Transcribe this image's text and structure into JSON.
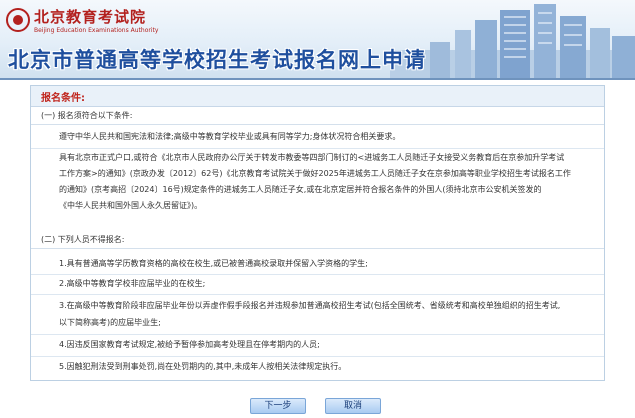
{
  "header": {
    "logo_cn": "北京教育考试院",
    "logo_en": "Beijing Education Examinations Authority",
    "title": "北京市普通高等学校招生考试报名网上申请"
  },
  "conditions": {
    "heading": "报名条件:",
    "section1_title": "(一) 报名须符合以下条件:",
    "section1_lines": [
      "遵守中华人民共和国宪法和法律;高级中等教育学校毕业或具有同等学力;身体状况符合相关要求。",
      "具有北京市正式户口,或符合《北京市人民政府办公厅关于转发市教委等四部门制订的<进城务工人员随迁子女接受义务教育后在京参加升学考试",
      "工作方案>的通知》(京政办发〔2012〕62号)《北京教育考试院关于做好2025年进城务工人员随迁子女在京参加高等职业学校招生考试报名工作",
      "的通知》(京考高招〔2024〕16号)规定条件的进城务工人员随迁子女,或在北京定居并符合报名条件的外国人(须持北京市公安机关签发的",
      "《中华人民共和国外国人永久居留证》)。"
    ],
    "section2_title": "(二) 下列人员不得报名:",
    "section2_lines": [
      "1.具有普通高等学历教育资格的高校在校生,或已被普通高校录取并保留入学资格的学生;",
      "2.高级中等教育学校非应届毕业的在校生;",
      "3.在高级中等教育阶段非应届毕业年份以弄虚作假手段报名并违规参加普通高校招生考试(包括全国统考、省级统考和高校单独组织的招生考试,",
      "以下简称高考)的应届毕业生;",
      "4.因违反国家教育考试规定,被给予暂停参加高考处理且在停考期内的人员;",
      "5.因触犯刑法受到刑事处罚,尚在处罚期内的,其中,未成年人按相关法律规定执行。"
    ]
  },
  "buttons": {
    "next": "下一步",
    "cancel": "取消"
  }
}
